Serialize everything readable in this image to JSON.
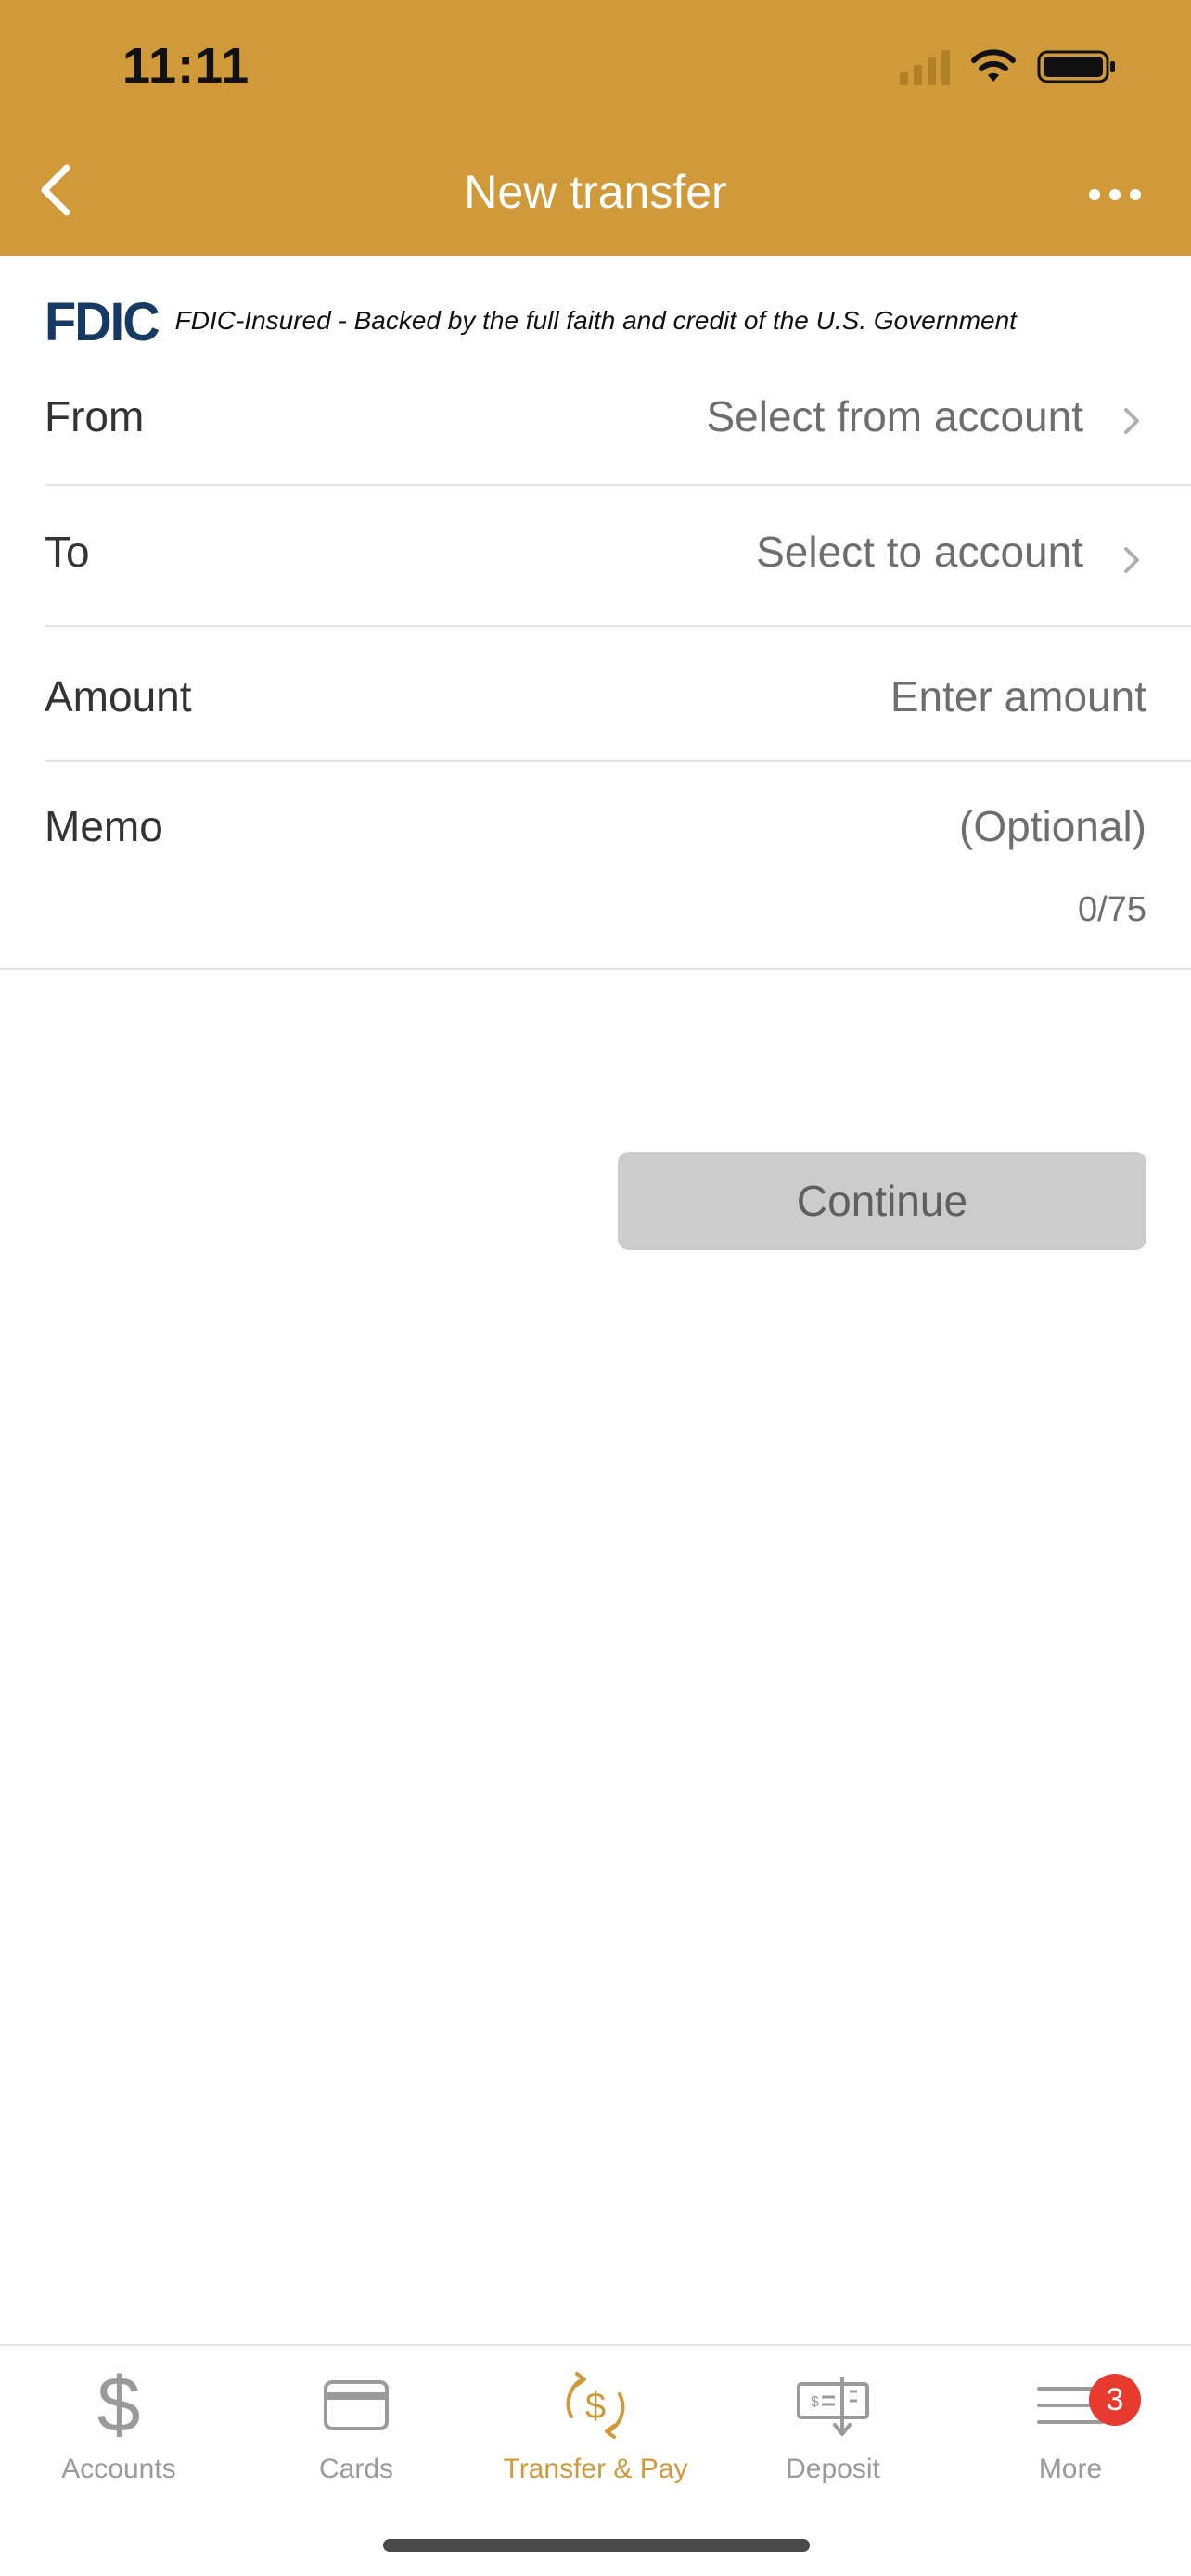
{
  "status_bar": {
    "time": "11:11"
  },
  "nav": {
    "title": "New transfer"
  },
  "fdic": {
    "logo": "FDIC",
    "text": "FDIC-Insured - Backed by the full faith and credit of the U.S. Government"
  },
  "form": {
    "from": {
      "label": "From",
      "value": "Select from account"
    },
    "to": {
      "label": "To",
      "value": "Select to account"
    },
    "amount": {
      "label": "Amount",
      "placeholder": "Enter amount"
    },
    "memo": {
      "label": "Memo",
      "placeholder": "(Optional)",
      "counter": "0/75"
    }
  },
  "continue_label": "Continue",
  "tabbar": {
    "tabs": [
      {
        "label": "Accounts",
        "icon": "dollar-icon"
      },
      {
        "label": "Cards",
        "icon": "card-icon"
      },
      {
        "label": "Transfer & Pay",
        "icon": "transfer-pay-icon",
        "active": true
      },
      {
        "label": "Deposit",
        "icon": "check-deposit-icon"
      },
      {
        "label": "More",
        "icon": "menu-icon",
        "badge": "3"
      }
    ]
  },
  "colors": {
    "brand": "#D09A3A",
    "fdic_navy": "#153A63",
    "badge": "#E63B2E",
    "button_disabled": "#CCCCCC"
  }
}
